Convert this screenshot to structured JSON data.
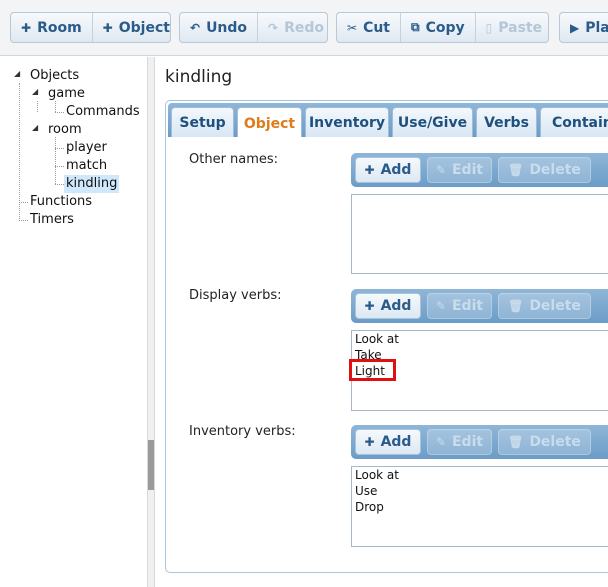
{
  "toolbar": {
    "room": "Room",
    "object": "Object",
    "undo": "Undo",
    "redo": "Redo",
    "cut": "Cut",
    "copy": "Copy",
    "paste": "Paste",
    "play": "Pla"
  },
  "tree": {
    "objects": "Objects",
    "game": "game",
    "commands": "Commands",
    "room": "room",
    "player": "player",
    "match": "match",
    "kindling": "kindling",
    "functions": "Functions",
    "timers": "Timers"
  },
  "editor": {
    "title": "kindling",
    "tabs": [
      "Setup",
      "Object",
      "Inventory",
      "Use/Give",
      "Verbs",
      "Containe"
    ],
    "active_tab": "Object",
    "add_label": "Add",
    "edit_label": "Edit",
    "delete_label": "Delete",
    "other_names": {
      "label": "Other names:",
      "items": []
    },
    "display_verbs": {
      "label": "Display verbs:",
      "items": [
        "Look at",
        "Take",
        "Light"
      ]
    },
    "inventory_verbs": {
      "label": "Inventory verbs:",
      "items": [
        "Look at",
        "Use",
        "Drop"
      ]
    }
  },
  "colors": {
    "accent": "#2a5b8a",
    "active_tab": "#e07b1a",
    "highlight": "#e01010"
  }
}
